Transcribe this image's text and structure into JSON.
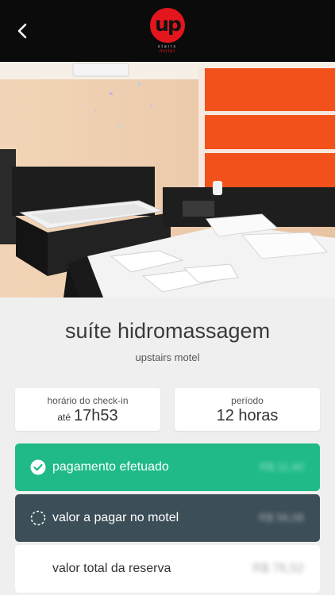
{
  "header": {
    "logo_text": "up",
    "logo_sub": "stairs",
    "logo_sub2": "motel",
    "back_icon": "chevron-left-icon"
  },
  "reservation": {
    "suite_name": "suíte hidromassagem",
    "motel_name": "upstairs motel",
    "checkin": {
      "label": "horário do check-in",
      "prefix": "até",
      "time": "17h53"
    },
    "period": {
      "label": "período",
      "value": "12 horas"
    }
  },
  "payment": {
    "paid": {
      "label": "pagamento efetuado",
      "amount": "R$ 11,40",
      "icon": "check-circle-icon",
      "color": "#1fba88"
    },
    "due": {
      "label": "valor a pagar no motel",
      "amount": "R$ 56,06",
      "icon": "dashed-circle-icon",
      "color": "#3c4e58"
    },
    "total": {
      "label": "valor total da reserva",
      "amount": "R$ 76,52"
    }
  }
}
